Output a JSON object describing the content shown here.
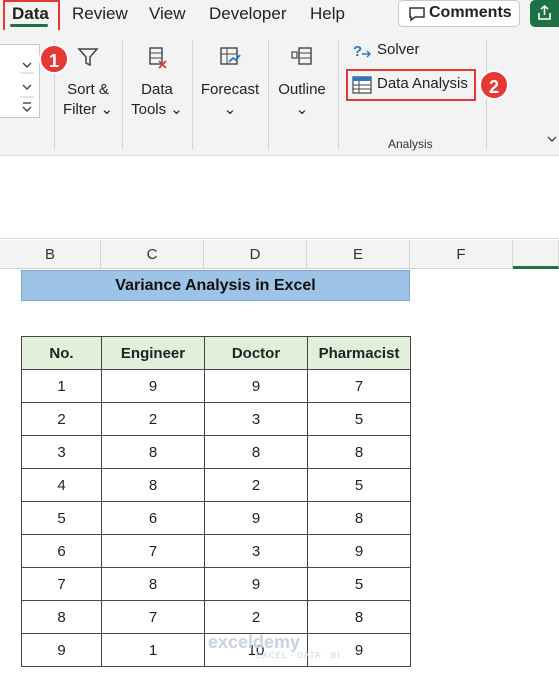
{
  "menu": {
    "items": [
      "Data",
      "Review",
      "View",
      "Developer",
      "Help"
    ],
    "comments_label": "Comments"
  },
  "badges": [
    "1",
    "2"
  ],
  "ribbon": {
    "sort_filter": [
      "Sort &",
      "Filter ⌄"
    ],
    "data_tools": [
      "Data",
      "Tools ⌄"
    ],
    "forecast": [
      "Forecast",
      "⌄"
    ],
    "outline": [
      "Outline",
      "⌄"
    ],
    "solver_label": "Solver",
    "data_analysis_label": "Data Analysis",
    "analysis_group_label": "Analysis"
  },
  "columns": [
    "B",
    "C",
    "D",
    "E",
    "F"
  ],
  "sheet": {
    "title": "Variance Analysis in Excel",
    "headers": [
      "No.",
      "Engineer",
      "Doctor",
      "Pharmacist"
    ],
    "rows": [
      [
        "1",
        "9",
        "9",
        "7"
      ],
      [
        "2",
        "2",
        "3",
        "5"
      ],
      [
        "3",
        "8",
        "8",
        "8"
      ],
      [
        "4",
        "8",
        "2",
        "5"
      ],
      [
        "5",
        "6",
        "9",
        "8"
      ],
      [
        "6",
        "7",
        "3",
        "9"
      ],
      [
        "7",
        "8",
        "9",
        "5"
      ],
      [
        "8",
        "7",
        "2",
        "8"
      ],
      [
        "9",
        "1",
        "10",
        "9"
      ]
    ]
  },
  "watermark": {
    "name": "exceldemy",
    "tagline": "EXCEL · DATA · BI"
  },
  "colors": {
    "accent": "#1e7145",
    "highlight": "#e53935",
    "title_fill": "#9dc3e6",
    "header_fill": "#e2efda"
  }
}
